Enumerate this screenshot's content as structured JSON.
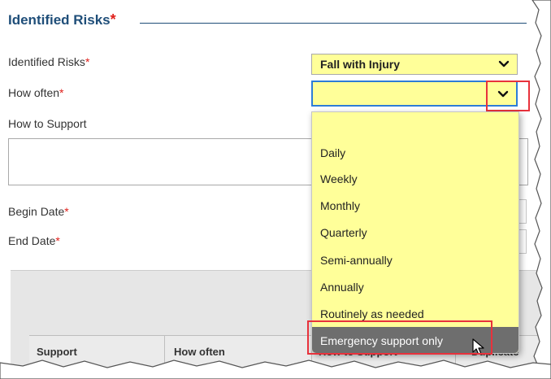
{
  "section": {
    "title": "Identified Risks",
    "required_mark": "*"
  },
  "form": {
    "identified_risks": {
      "label": "Identified Risks",
      "required_mark": "*",
      "value": "Fall with Injury"
    },
    "how_often": {
      "label": "How often",
      "required_mark": "*",
      "value": ""
    },
    "how_to_support": {
      "label": "How to Support",
      "value": ""
    },
    "begin_date": {
      "label": "Begin Date",
      "required_mark": "*"
    },
    "end_date": {
      "label": "End Date",
      "required_mark": "*"
    }
  },
  "dropdown": {
    "options": [
      "",
      "Daily",
      "Weekly",
      "Monthly",
      "Quarterly",
      "Semi-annually",
      "Annually",
      "Routinely as needed",
      "Emergency support only"
    ],
    "highlighted_option": "Emergency support only"
  },
  "table": {
    "columns": [
      "Support",
      "How often",
      "How to Support",
      "Duplicate"
    ]
  },
  "colors": {
    "field_background": "#ffff99",
    "heading": "#1f4e79",
    "required": "#e0201b",
    "annotation": "#e8323c",
    "focus_border": "#2e7dd7",
    "selected_option": "#6e6e6e"
  },
  "icons": [
    "chevron-down-icon",
    "mouse-pointer-icon"
  ]
}
